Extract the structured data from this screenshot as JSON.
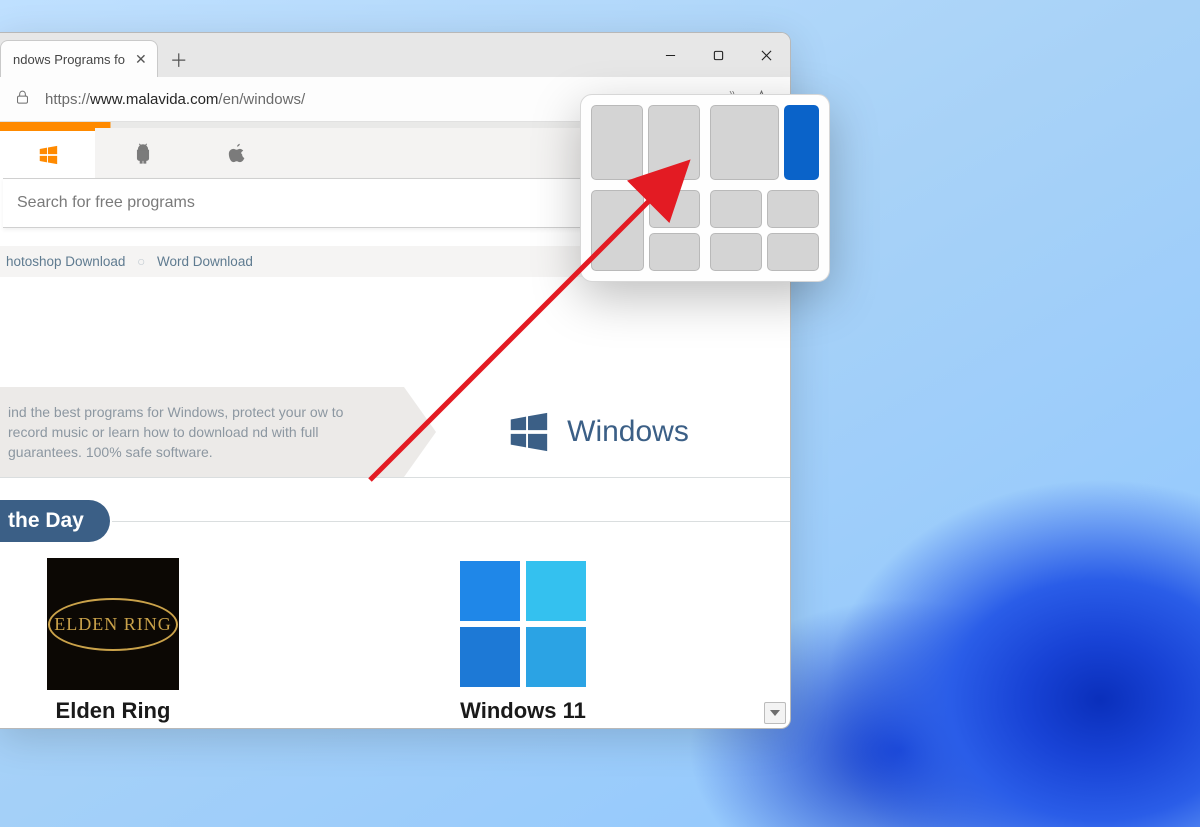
{
  "browser": {
    "tab_title": "ndows Programs fo",
    "url_scheme": "https://",
    "url_host": "www.malavida.com",
    "url_path": "/en/windows/",
    "read_aloud_label": "A",
    "platforms": [
      "windows",
      "android",
      "apple"
    ]
  },
  "search": {
    "placeholder": "Search for free programs"
  },
  "quicklinks": {
    "items": [
      "hotoshop Download",
      "Word Download"
    ]
  },
  "hero": {
    "tagline": "ind the best programs for Windows, protect your ow to record music or learn how to download nd with full guarantees. 100% safe software.",
    "title": "Windows"
  },
  "section": {
    "title": "the Day"
  },
  "apps": [
    {
      "name": "Elden Ring",
      "thumb": "elden"
    },
    {
      "name": "Windows 11",
      "thumb": "win11"
    }
  ],
  "snap": {
    "layouts": [
      {
        "type": "split-2",
        "selected_cell": null
      },
      {
        "type": "two-thirds",
        "selected_cell": 1
      },
      {
        "type": "split-h-then-v",
        "selected_cell": null
      },
      {
        "type": "quad",
        "selected_cell": null
      }
    ]
  },
  "colors": {
    "accent_orange": "#ff8a00",
    "brand_blue": "#3b5f86",
    "win_blue": "#0a63c9"
  }
}
